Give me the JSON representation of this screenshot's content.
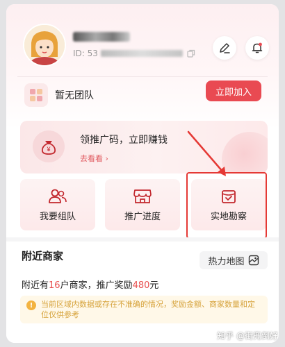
{
  "profile": {
    "id_prefix": "ID: 53",
    "avatar_icon": "cartoon-girl-avatar-icon"
  },
  "header_actions": {
    "edit_icon": "edit-pen-icon",
    "notify_icon": "bell-icon"
  },
  "team": {
    "status": "暂无团队",
    "join_label": "立即加入",
    "icon": "team-icon"
  },
  "promo": {
    "title": "领推广码，立即赚钱",
    "link": "去看看 ›",
    "icon": "money-bag-icon"
  },
  "tiles": [
    {
      "label": "我要组队",
      "icon": "group-icon"
    },
    {
      "label": "推广进度",
      "icon": "store-icon"
    },
    {
      "label": "实地勘察",
      "icon": "inspection-check-icon"
    }
  ],
  "nearby": {
    "title": "附近商家",
    "map_label": "热力地图",
    "count_prefix": "附近有",
    "count": "16",
    "count_mid": "户商家，推广奖励",
    "reward": "480",
    "reward_suffix": "元",
    "notice": "当前区域内数据或存在不准确的情况，奖励金额、商家数量和定位仅供参考"
  },
  "watermark": "知乎 @街兜倒好",
  "colors": {
    "accent": "#e94a52",
    "highlight": "#e53935",
    "notice_text": "#d6a23a"
  }
}
